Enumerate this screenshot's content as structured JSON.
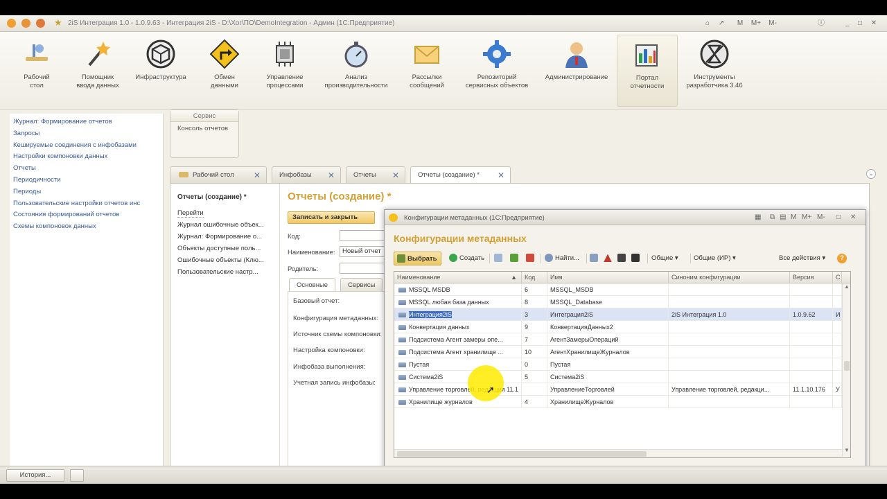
{
  "window": {
    "title": "2iS Интеграция 1.0 - 1.0.9.63 - Интеграция 2iS - D:\\Хог\\ПО\\DemoIntegration - Админ  (1С:Предприятие)",
    "right_controls": [
      "M",
      "M+",
      "M-"
    ]
  },
  "ribbon": {
    "items": [
      {
        "label": "Рабочий\nстол",
        "icon": "desktop-icon"
      },
      {
        "label": "Помощник\nввода данных",
        "icon": "magic-wand-icon"
      },
      {
        "label": "Инфраструктура",
        "icon": "cube-icon"
      },
      {
        "label": "Обмен\nданными",
        "icon": "road-sign-icon"
      },
      {
        "label": "Управление\nпроцессами",
        "icon": "chip-icon"
      },
      {
        "label": "Анализ\nпроизводительности",
        "icon": "stopwatch-icon"
      },
      {
        "label": "Рассылки\nсообщений",
        "icon": "envelope-icon"
      },
      {
        "label": "Репозиторий\nсервисных объектов",
        "icon": "gear-icon"
      },
      {
        "label": "Администрирование",
        "icon": "admin-user-icon"
      },
      {
        "label": "Портал\nотчетности",
        "icon": "report-portal-icon"
      },
      {
        "label": "Инструменты\nразработчика 3.46",
        "icon": "hourglass-icon"
      }
    ]
  },
  "left_panel": {
    "links": [
      "Журнал: Формирование отчетов",
      "Запросы",
      "Кешируемые соединения с инфобазами",
      "Настройки компоновки данных",
      "Отчеты",
      "Периодичности",
      "Периоды",
      "Пользовательские настройки отчетов инс",
      "Состояния формирований отчетов",
      "Схемы компоновок данных"
    ]
  },
  "service": {
    "header": "Сервис",
    "item": "Консоль отчетов"
  },
  "tabs": [
    {
      "label": "Рабочий стол"
    },
    {
      "label": "Инфобазы"
    },
    {
      "label": "Отчеты"
    },
    {
      "label": "Отчеты (создание) *"
    }
  ],
  "nav": {
    "title": "Отчеты (создание) *",
    "goto": "Перейти",
    "links": [
      "Журнал ошибочные объек...",
      "Журнал: Формирование о...",
      "Объекты доступные поль...",
      "Ошибочные объекты (Клю...",
      "Пользовательские настр..."
    ]
  },
  "form": {
    "title": "Отчеты (создание) *",
    "save_button": "Записать и закрыть",
    "code_label": "Код:",
    "name_label": "Наименование:",
    "name_value": "Новый отчет",
    "parent_label": "Родитель:",
    "tabs": [
      "Основные",
      "Сервисы"
    ],
    "fields": [
      "Базовый отчет:",
      "Конфигурация метаданных:",
      "Источник схемы компоновки:",
      "Настройка компоновки:",
      "Инфобаза выполнения:",
      "Учетная запись инфобазы:"
    ]
  },
  "dialog": {
    "title": "Конфигурации метаданных  (1С:Предприятие)",
    "heading": "Конфигурации метаданных",
    "toolbar": {
      "select": "Выбрать",
      "create": "Создать",
      "find": "Найти...",
      "general": "Общие",
      "general_ir": "Общие (ИР)",
      "all_actions": "Все действия",
      "help": "?"
    },
    "columns": [
      "Наименование",
      "Код",
      "Имя",
      "Синоним конфигурации",
      "Версия",
      "С"
    ],
    "rows": [
      {
        "name": "MSSQL MSDB",
        "code": "6",
        "id": "MSSQL_MSDB",
        "synonym": "",
        "version": "",
        "extra": ""
      },
      {
        "name": "MSSQL любая база данных",
        "code": "8",
        "id": "MSSQL_Database",
        "synonym": "",
        "version": "",
        "extra": ""
      },
      {
        "name": "Интеграция2iS",
        "code": "3",
        "id": "Интеграция2iS",
        "synonym": "2iS Интеграция 1.0",
        "version": "1.0.9.62",
        "extra": "И"
      },
      {
        "name": "Конвертация данных",
        "code": "9",
        "id": "КонвертацияДанных2",
        "synonym": "",
        "version": "",
        "extra": ""
      },
      {
        "name": "Подсистема Агент замеры опе...",
        "code": "7",
        "id": "АгентЗамерыОпераций",
        "synonym": "",
        "version": "",
        "extra": ""
      },
      {
        "name": "Подсистема Агент хранилище ...",
        "code": "10",
        "id": "АгентХранилищеЖурналов",
        "synonym": "",
        "version": "",
        "extra": ""
      },
      {
        "name": "Пустая",
        "code": "0",
        "id": "Пустая",
        "synonym": "",
        "version": "",
        "extra": ""
      },
      {
        "name": "Система2iS",
        "code": "5",
        "id": "Система2iS",
        "synonym": "",
        "version": "",
        "extra": ""
      },
      {
        "name": "Управление торговлей, редакция 11.1",
        "code": "",
        "id": "УправлениеТорговлей",
        "synonym": "Управление торговлей, редакци...",
        "version": "11.1.10.176",
        "extra": "У"
      },
      {
        "name": "Хранилище журналов",
        "code": "4",
        "id": "ХранилищеЖурналов",
        "synonym": "",
        "version": "",
        "extra": ""
      }
    ],
    "selected_row": 2
  },
  "statusbar": {
    "history": "История..."
  },
  "colors": {
    "accent_title": "#d4a033",
    "link": "#3b5a96",
    "selection": "#3b6bc6"
  }
}
